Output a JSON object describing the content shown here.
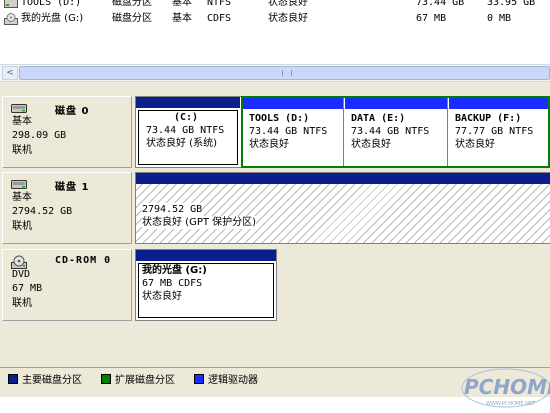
{
  "volumes": [
    {
      "name": "TOOLS (D:)",
      "layout": "磁盘分区",
      "type": "基本",
      "fs": "NTFS",
      "status": "状态良好",
      "capacity": "73.44 GB",
      "free": "33.95 GB"
    },
    {
      "name": "我的光盘 (G:)",
      "layout": "磁盘分区",
      "type": "基本",
      "fs": "CDFS",
      "status": "状态良好",
      "capacity": "67 MB",
      "free": "0 MB"
    }
  ],
  "scrollbar": {
    "left_arrow": "<"
  },
  "disks": [
    {
      "name": "磁盘 0",
      "icon": "hard-disk-icon",
      "kind": "基本",
      "size": "298.09 GB",
      "state": "联机",
      "partitions": [
        {
          "name": "(C:)",
          "line1": "73.44 GB NTFS",
          "line2": "状态良好 (系统)"
        },
        {
          "name": "TOOLS  (D:)",
          "line1": "73.44 GB NTFS",
          "line2": "状态良好"
        },
        {
          "name": "DATA  (E:)",
          "line1": "73.44 GB NTFS",
          "line2": "状态良好"
        },
        {
          "name": "BACKUP  (F:)",
          "line1": "77.77 GB NTFS",
          "line2": "状态良好"
        }
      ]
    },
    {
      "name": "磁盘 1",
      "icon": "hard-disk-icon",
      "kind": "基本",
      "size": "2794.52 GB",
      "state": "联机",
      "partitions": [
        {
          "name": "",
          "line1": "2794.52 GB",
          "line2": "状态良好 (GPT 保护分区)"
        }
      ]
    },
    {
      "name": "CD-ROM 0",
      "icon": "cdrom-icon",
      "kind": "DVD",
      "size": "67 MB",
      "state": "联机",
      "partitions": [
        {
          "name": "我的光盘  (G:)",
          "line1": "67 MB CDFS",
          "line2": "状态良好"
        }
      ]
    }
  ],
  "legend": [
    {
      "label": "主要磁盘分区",
      "color": "#0a1e8c"
    },
    {
      "label": "扩展磁盘分区",
      "color": "#008000"
    },
    {
      "label": "逻辑驱动器",
      "color": "#1a2cff"
    }
  ],
  "colors": {
    "primary": "#0a1e8c",
    "extended": "#008000",
    "logical": "#1a2cff"
  },
  "watermark": {
    "brand": "PCHOME",
    "url": "WWW.PCHOME.NET"
  }
}
